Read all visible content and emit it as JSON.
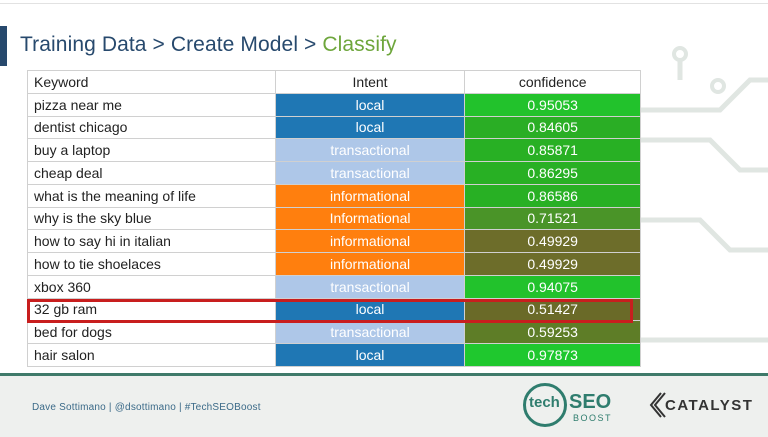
{
  "slide": {
    "title_part1": "Training Data",
    "sep1": " > ",
    "title_part2": "Create Model",
    "sep2": " > ",
    "title_part3": "Classify"
  },
  "table": {
    "headers": [
      "Keyword",
      "Intent",
      "confidence"
    ],
    "rows": [
      {
        "keyword": "pizza near me",
        "intent": "local",
        "confidence": "0.95053",
        "intent_color": "#1f77b4",
        "conf_color": "#22c22c"
      },
      {
        "keyword": "dentist chicago",
        "intent": "local",
        "confidence": "0.84605",
        "intent_color": "#1f77b4",
        "conf_color": "#2aae25"
      },
      {
        "keyword": "buy a laptop",
        "intent": "transactional",
        "confidence": "0.85871",
        "intent_color": "#aec7e8",
        "conf_color": "#28b024"
      },
      {
        "keyword": "cheap deal",
        "intent": "transactional",
        "confidence": "0.86295",
        "intent_color": "#aec7e8",
        "conf_color": "#28b024"
      },
      {
        "keyword": "what is the meaning of life",
        "intent": "informational",
        "confidence": "0.86586",
        "intent_color": "#ff7f0e",
        "conf_color": "#28b024"
      },
      {
        "keyword": "why is the sky blue",
        "intent": "Informational",
        "confidence": "0.71521",
        "intent_color": "#ff7f0e",
        "conf_color": "#4a9428"
      },
      {
        "keyword": "how to say hi in italian",
        "intent": "informational",
        "confidence": "0.49929",
        "intent_color": "#ff7f0e",
        "conf_color": "#6d6d2a"
      },
      {
        "keyword": "how to tie shoelaces",
        "intent": "informational",
        "confidence": "0.49929",
        "intent_color": "#ff7f0e",
        "conf_color": "#6d6d2a"
      },
      {
        "keyword": "xbox 360",
        "intent": "transactional",
        "confidence": "0.94075",
        "intent_color": "#aec7e8",
        "conf_color": "#22c22c"
      },
      {
        "keyword": "32 gb ram",
        "intent": "local",
        "confidence": "0.51427",
        "intent_color": "#1f77b4",
        "conf_color": "#6a6a28"
      },
      {
        "keyword": "bed for dogs",
        "intent": "transactional",
        "confidence": "0.59253",
        "intent_color": "#aec7e8",
        "conf_color": "#5e7d27"
      },
      {
        "keyword": "hair salon",
        "intent": "local",
        "confidence": "0.97873",
        "intent_color": "#1f77b4",
        "conf_color": "#1fc82e"
      }
    ]
  },
  "footer": {
    "credit": "Dave Sottimano  |  @dsottimano  |  #TechSEOBoost",
    "logo1_tech": "tech",
    "logo1_seo": "SEO",
    "logo1_boost": "BOOST",
    "logo2_text": "CATALYST"
  },
  "colors": {
    "title": "#27496d",
    "title_active": "#6ea63c",
    "highlight": "#c81e1e",
    "footer_bg": "#eef0ee",
    "footer_line": "#3f7a6a"
  }
}
